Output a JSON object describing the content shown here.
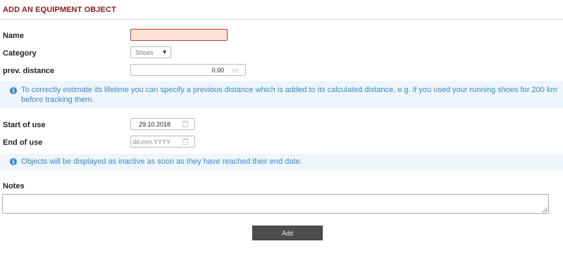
{
  "header": {
    "title": "ADD AN EQUIPMENT OBJECT"
  },
  "fields": {
    "name": {
      "label": "Name",
      "value": ""
    },
    "category": {
      "label": "Category",
      "value": "Shoes"
    },
    "prev_distance": {
      "label": "prev. distance",
      "value": "0.00",
      "unit": "mi"
    },
    "start_of_use": {
      "label": "Start of use",
      "value": "29.10.2018"
    },
    "end_of_use": {
      "label": "End of use",
      "placeholder": "dd.mm.YYYY"
    },
    "notes": {
      "label": "Notes",
      "value": ""
    }
  },
  "info": {
    "distance_hint": "To correctly estimate its lifetime you can specify a previous distance which is added to its calculated distance, e.g. if you used your running shoes for 200 km before tracking them.",
    "inactive_hint": "Objects will be displayed as inactive as soon as they have reached their end date."
  },
  "icons": {
    "info": "info-icon",
    "calendar": "calendar-icon",
    "dropdown": "chevron-down-icon"
  },
  "colors": {
    "title": "#8b1a1a",
    "info_text": "#3a8bc2",
    "info_bg": "#eef5fb",
    "error_border": "#c0392b",
    "error_bg": "#fde3d6",
    "button_bg": "#4d4d4d"
  },
  "actions": {
    "add_label": "Add"
  }
}
